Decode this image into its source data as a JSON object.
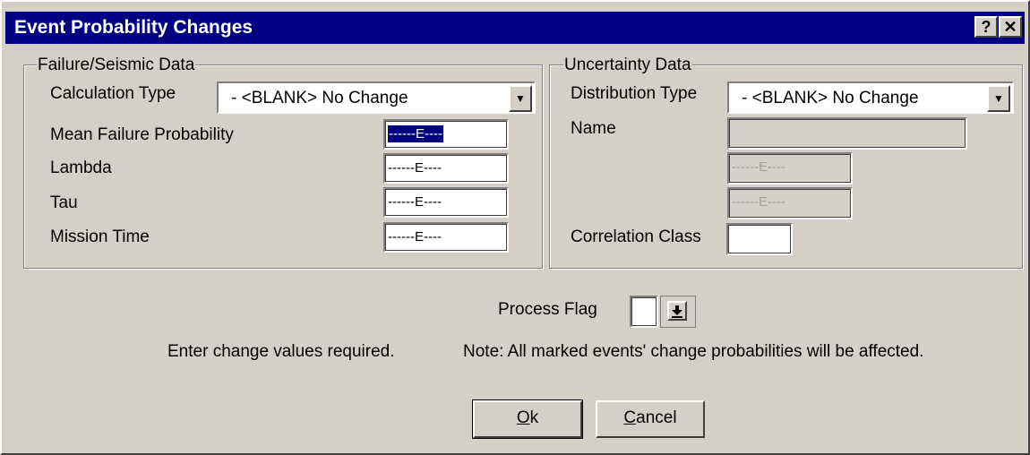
{
  "window": {
    "title": "Event Probability Changes",
    "help_glyph": "?",
    "close_glyph": "✕"
  },
  "failure_group": {
    "legend": "Failure/Seismic Data",
    "calculation_type_label": "Calculation Type",
    "calculation_type_value": "- <BLANK> No Change",
    "mean_failure_label": "Mean Failure Probability",
    "mean_failure_value": "------E----",
    "lambda_label": "Lambda",
    "lambda_value": "------E----",
    "tau_label": "Tau",
    "tau_value": "------E----",
    "mission_time_label": "Mission Time",
    "mission_time_value": "------E----"
  },
  "uncertainty_group": {
    "legend": "Uncertainty Data",
    "distribution_type_label": "Distribution Type",
    "distribution_type_value": "- <BLANK> No Change",
    "name_label": "Name",
    "name_value": "",
    "param1_value": "------E----",
    "param2_value": "------E----",
    "correlation_class_label": "Correlation Class",
    "correlation_class_value": ""
  },
  "process_flag": {
    "label": "Process Flag",
    "value": "",
    "dropdown_icon": "down-arrow-to-line-icon"
  },
  "messages": {
    "instruction": "Enter change values required.",
    "note": "Note: All marked events' change probabilities will be affected."
  },
  "buttons": {
    "ok_mnemonic": "O",
    "ok_rest": "k",
    "cancel_mnemonic": "C",
    "cancel_rest": "ancel"
  }
}
